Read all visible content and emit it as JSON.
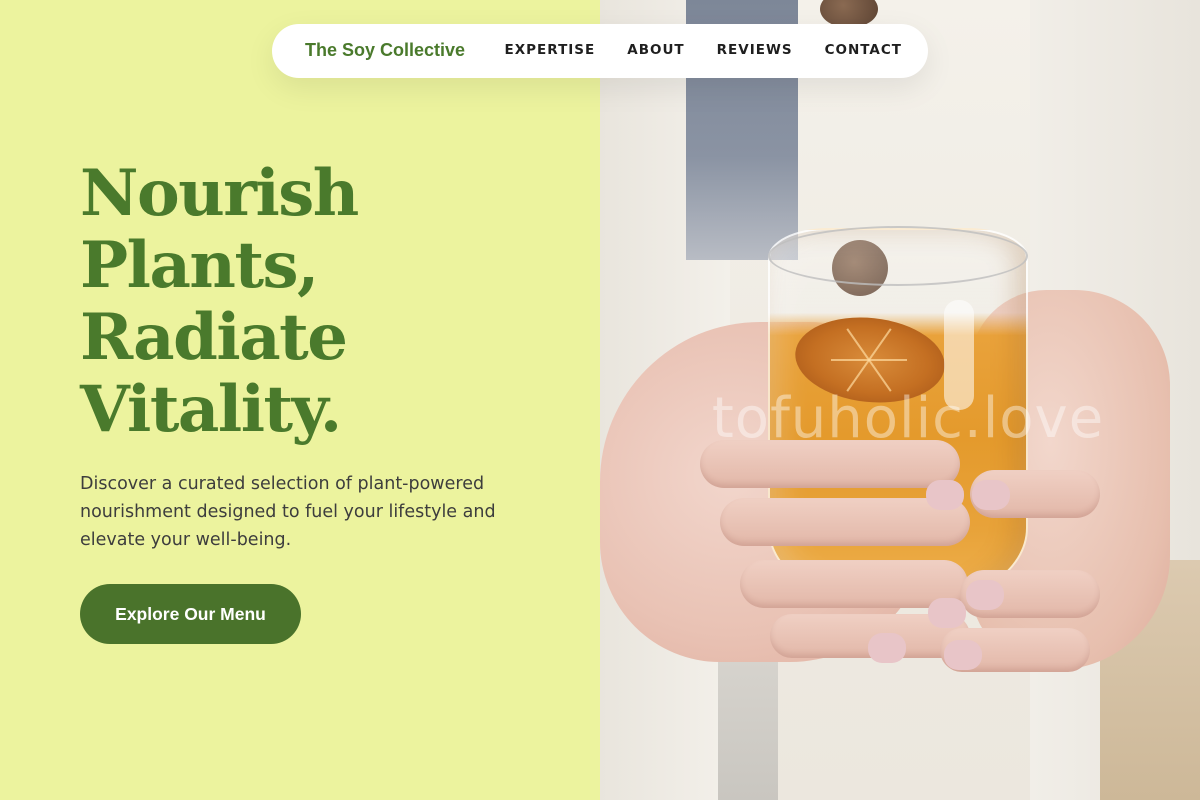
{
  "brand": {
    "name": "The Soy Collective",
    "color": "#4a7a2c"
  },
  "nav": {
    "links": [
      {
        "label": "EXPERTISE"
      },
      {
        "label": "ABOUT"
      },
      {
        "label": "REVIEWS"
      },
      {
        "label": "CONTACT"
      }
    ]
  },
  "hero": {
    "headline_lines": [
      "Nourish",
      "Plants,",
      "Radiate",
      "Vitality."
    ],
    "description": "Discover a curated selection of plant-powered nourishment designed to fuel your lifestyle and elevate your well-being.",
    "cta_label": "Explore Our Menu",
    "background_color": "#ecf39e",
    "accent_color": "#4a732b"
  },
  "photo": {
    "watermark": "tofuholic.love",
    "subject": "hands holding glass of orange drink with dried orange slice"
  }
}
